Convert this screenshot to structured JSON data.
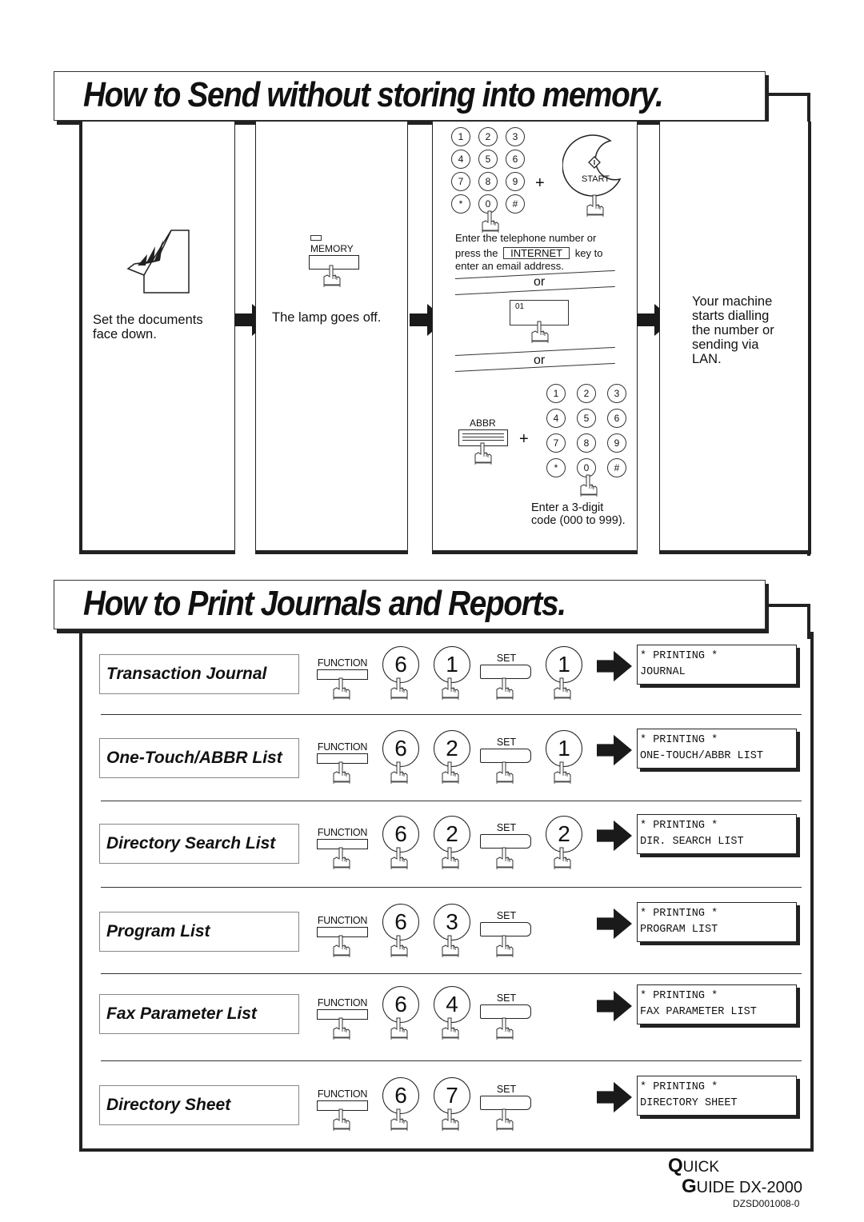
{
  "send_section": {
    "title": "How to Send without storing into memory.",
    "step1": {
      "text_line1": "Set the documents",
      "text_line2": "face down."
    },
    "step2": {
      "key_label": "MEMORY",
      "text": "The lamp goes off."
    },
    "step3": {
      "keypad_keys": [
        "1",
        "2",
        "3",
        "4",
        "5",
        "6",
        "7",
        "8",
        "9",
        "*",
        "0",
        "#"
      ],
      "plus": "+",
      "start_label": "START",
      "instr_line1": "Enter the telephone number or",
      "instr_line2_pre": "press the",
      "internet_key": "INTERNET",
      "instr_line2_post": "key to",
      "instr_line3": "enter an email address.",
      "or1": "or",
      "one_touch_label": "01",
      "or2": "or",
      "abbr_label": "ABBR",
      "abbr_plus": "+",
      "code_line1": "Enter a 3-digit",
      "code_line2": "code (000 to 999)."
    },
    "step4": {
      "lines": [
        "Your machine",
        "starts dialling",
        "the number or",
        "sending via",
        "LAN."
      ]
    }
  },
  "print_section": {
    "title": "How to Print Journals and Reports.",
    "function_label": "FUNCTION",
    "set_label": "SET",
    "rows": [
      {
        "label": "Transaction Journal",
        "keys": [
          "6",
          "1"
        ],
        "after_set": "1",
        "lcd_line1": "* PRINTING *",
        "lcd_line2": "JOURNAL"
      },
      {
        "label": "One-Touch/ABBR List",
        "keys": [
          "6",
          "2"
        ],
        "after_set": "1",
        "lcd_line1": "* PRINTING *",
        "lcd_line2": "ONE-TOUCH/ABBR LIST"
      },
      {
        "label": "Directory Search List",
        "keys": [
          "6",
          "2"
        ],
        "after_set": "2",
        "lcd_line1": "* PRINTING *",
        "lcd_line2": "DIR. SEARCH LIST"
      },
      {
        "label": "Program List",
        "keys": [
          "6",
          "3"
        ],
        "after_set": null,
        "lcd_line1": "* PRINTING *",
        "lcd_line2": "PROGRAM LIST"
      },
      {
        "label": "Fax Parameter List",
        "keys": [
          "6",
          "4"
        ],
        "after_set": null,
        "lcd_line1": "* PRINTING *",
        "lcd_line2": "FAX PARAMETER LIST"
      },
      {
        "label": "Directory Sheet",
        "keys": [
          "6",
          "7"
        ],
        "after_set": null,
        "lcd_line1": "* PRINTING *",
        "lcd_line2": "DIRECTORY SHEET"
      }
    ]
  },
  "footer": {
    "quick_q": "Q",
    "quick_rest": "UICK",
    "guide_g": "G",
    "guide_rest": "UIDE DX-2000",
    "doc_code": "DZSD001008-0"
  }
}
